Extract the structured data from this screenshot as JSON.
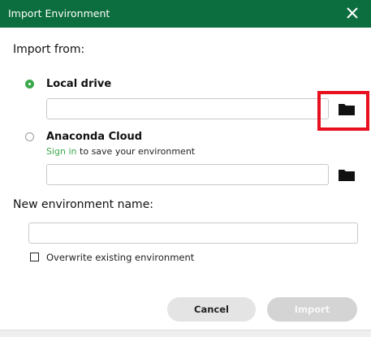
{
  "dialog": {
    "title": "Import Environment"
  },
  "import_from": {
    "heading": "Import from:",
    "local_drive": {
      "label": "Local drive",
      "selected": true,
      "path_value": ""
    },
    "anaconda_cloud": {
      "label": "Anaconda Cloud",
      "selected": false,
      "hint_link": "Sign in",
      "hint_text": " to save your environment",
      "path_value": ""
    }
  },
  "env_name": {
    "heading": "New environment name:",
    "value": ""
  },
  "overwrite": {
    "label": "Overwrite existing environment",
    "checked": false
  },
  "buttons": {
    "cancel": "Cancel",
    "import": "Import"
  },
  "icons": {
    "close": "close-icon",
    "folder": "folder-icon"
  },
  "colors": {
    "titlebar": "#0c6e3e",
    "accent": "#3aa84a",
    "highlight": "#e8101e"
  }
}
